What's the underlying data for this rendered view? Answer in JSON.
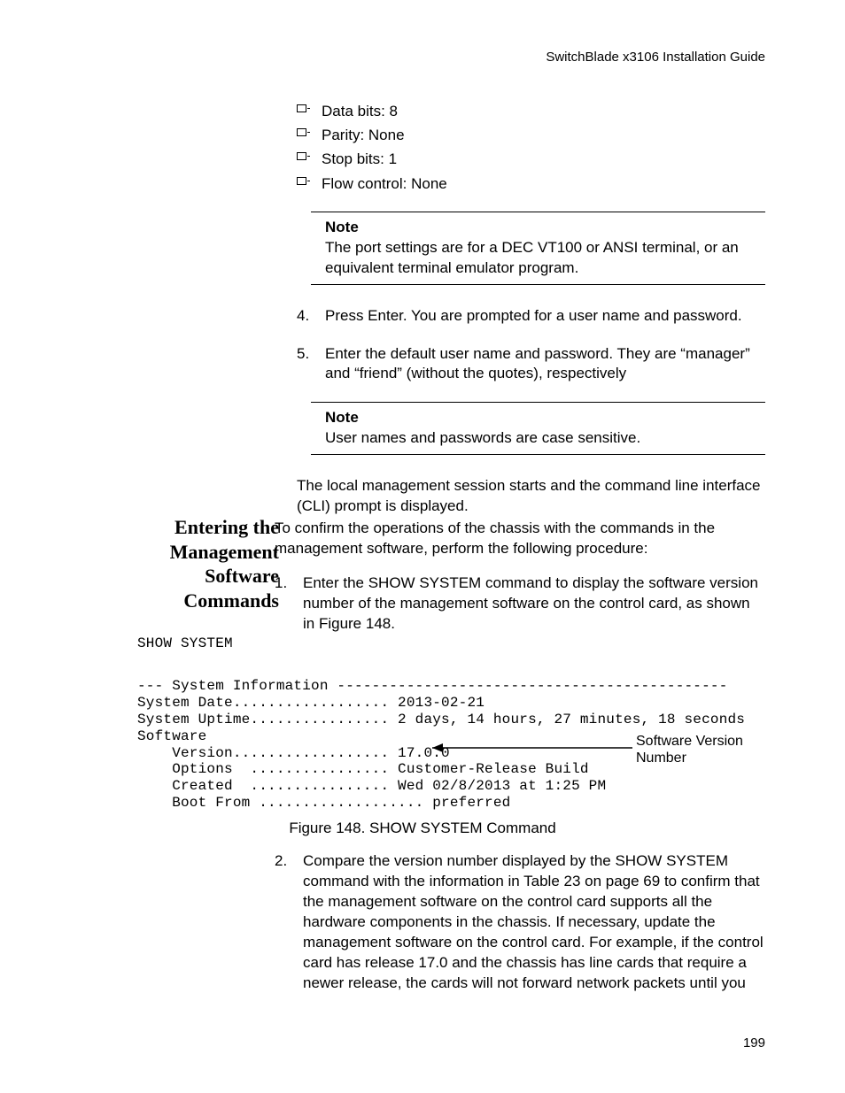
{
  "header": {
    "guide": "SwitchBlade x3106 Installation Guide"
  },
  "bullets": {
    "b0": "Data bits: 8",
    "b1": "Parity: None",
    "b2": "Stop bits: 1",
    "b3": "Flow control: None"
  },
  "note1": {
    "title": "Note",
    "body": "The port settings are for a DEC VT100 or ANSI terminal, or an equivalent terminal emulator program."
  },
  "steps1": {
    "s4": "Press Enter. You are prompted for a user name and password.",
    "s5": "Enter the default user name and password. They are “manager” and “friend” (without the quotes), respectively"
  },
  "note2": {
    "title": "Note",
    "body": "User names and passwords are case sensitive."
  },
  "para_cli": "The local management session starts and the command line interface (CLI) prompt is displayed.",
  "section2": {
    "heading": "Entering the Management Software Commands",
    "intro": "To confirm the operations of the chassis with the commands in the management software, perform the following procedure:",
    "step1": "Enter the SHOW SYSTEM command to display the software version number of the management software on the control card, as shown in Figure 148."
  },
  "code": {
    "cmd": "SHOW SYSTEM",
    "out": "--- System Information ---------------------------------------------\nSystem Date.................. 2013-02-21\nSystem Uptime................ 2 days, 14 hours, 27 minutes, 18 seconds\nSoftware\n    Version.................. 17.0.0\n    Options  ................ Customer-Release Build\n    Created  ................ Wed 02/8/2013 at 1:25 PM\n    Boot From ................... preferred"
  },
  "annotation": "Software Version Number",
  "figure_caption": "Figure 148. SHOW SYSTEM Command",
  "step2": "Compare the version number displayed by the SHOW SYSTEM command with the information in Table 23 on page 69 to confirm that the management software on the control card supports all the hardware components in the chassis. If necessary, update the management software on the control card. For example, if the control card has release 17.0 and the chassis has line cards that require a newer release, the cards will not forward network packets until you",
  "page_number": "199",
  "chart_data": {
    "type": "table",
    "title": "SHOW SYSTEM Command output",
    "rows": [
      {
        "field": "System Date",
        "value": "2013-02-21"
      },
      {
        "field": "System Uptime",
        "value": "2 days, 14 hours, 27 minutes, 18 seconds"
      },
      {
        "field": "Software Version",
        "value": "17.0.0"
      },
      {
        "field": "Software Options",
        "value": "Customer-Release Build"
      },
      {
        "field": "Software Created",
        "value": "Wed 02/8/2013 at 1:25 PM"
      },
      {
        "field": "Software Boot From",
        "value": "preferred"
      }
    ]
  }
}
